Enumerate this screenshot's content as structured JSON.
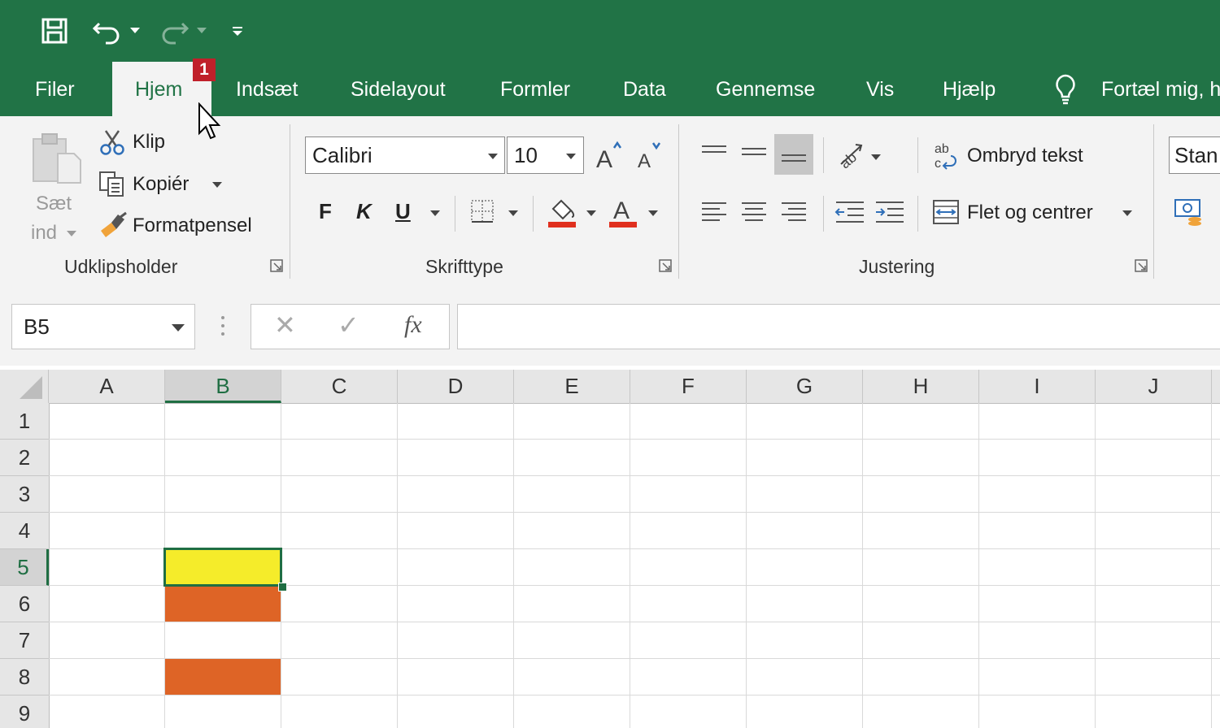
{
  "quick_access": {
    "save_icon": "save-icon",
    "undo_icon": "undo-icon",
    "redo_icon": "redo-icon",
    "customize_icon": "customize-qat-icon"
  },
  "tabs": {
    "filer": "Filer",
    "hjem": "Hjem",
    "hjem_badge": "1",
    "indsaet": "Indsæt",
    "sidelayout": "Sidelayout",
    "formler": "Formler",
    "data": "Data",
    "gennemse": "Gennemse",
    "vis": "Vis",
    "hjaelp": "Hjælp",
    "tell_me": "Fortæl mig, h"
  },
  "clipboard": {
    "paste_line1": "Sæt",
    "paste_line2": "ind",
    "cut": "Klip",
    "copy": "Kopiér",
    "format_painter": "Formatpensel",
    "group_label": "Udklipsholder"
  },
  "font": {
    "font_name": "Calibri",
    "font_size": "10",
    "bold": "F",
    "italic": "K",
    "underline": "U",
    "group_label": "Skrifttype"
  },
  "alignment": {
    "wrap_text": "Ombryd tekst",
    "merge_center": "Flet og centrer",
    "group_label": "Justering"
  },
  "styles": {
    "style_box": "Stan"
  },
  "formula_bar": {
    "name_box": "B5",
    "cancel": "✕",
    "enter": "✓",
    "fx": "fx",
    "formula": ""
  },
  "columns": [
    "A",
    "B",
    "C",
    "D",
    "E",
    "F",
    "G",
    "H",
    "I",
    "J"
  ],
  "rows": [
    "1",
    "2",
    "3",
    "4",
    "5",
    "6",
    "7",
    "8",
    "9"
  ],
  "selected_cell": "B5",
  "cell_fills": [
    {
      "cell": "B5",
      "color": "#f5ec2a"
    },
    {
      "cell": "B6",
      "color": "#de6426"
    },
    {
      "cell": "B8",
      "color": "#de6426"
    }
  ],
  "colors": {
    "titlebar": "#217346",
    "ribbon": "#f3f3f3",
    "selection": "#1f6e43",
    "fill_yellow": "#f5ec2a",
    "fill_orange": "#de6426",
    "font_color_red": "#e0301e"
  }
}
